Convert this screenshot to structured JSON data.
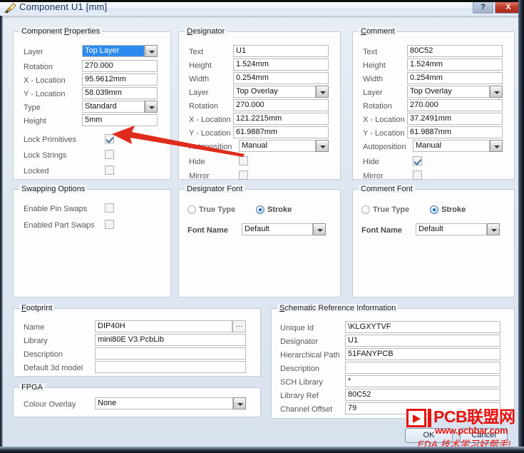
{
  "window": {
    "title": "Component U1 [mm]",
    "icon": "component-pencil-icon",
    "help_label": "?",
    "close_label": "X",
    "accent_blue": "#2d8bef",
    "watermark_red": "#e8140f"
  },
  "component_properties": {
    "title": "Component Properties",
    "title_prefix": "Component ",
    "title_underlined": "P",
    "title_suffix": "roperties",
    "rows": [
      {
        "label": "Layer",
        "value": "Top Layer",
        "type": "combo-selected"
      },
      {
        "label": "Rotation",
        "value": "270.000",
        "type": "text"
      },
      {
        "label": "X - Location",
        "value": "95.9612mm",
        "type": "text"
      },
      {
        "label": "Y - Location",
        "value": "58.039mm",
        "type": "text"
      },
      {
        "label": "Type",
        "value": "Standard",
        "type": "combo"
      },
      {
        "label": "Height",
        "value": "5mm",
        "type": "text"
      }
    ],
    "checkboxes": [
      {
        "label": "Lock Primitives",
        "checked": true
      },
      {
        "label": "Lock Strings",
        "checked": false
      },
      {
        "label": "Locked",
        "checked": false
      }
    ]
  },
  "designator": {
    "title": "Designator",
    "title_underlined": "D",
    "title_suffix": "esignator",
    "rows": [
      {
        "label": "Text",
        "value": "U1",
        "type": "text"
      },
      {
        "label": "Height",
        "value": "1.524mm",
        "type": "text"
      },
      {
        "label": "Width",
        "value": "0.254mm",
        "type": "text"
      },
      {
        "label": "Layer",
        "value": "Top Overlay",
        "type": "combo"
      },
      {
        "label": "Rotation",
        "value": "270.000",
        "type": "text"
      },
      {
        "label": "X - Location",
        "value": "121.2215mm",
        "type": "text"
      },
      {
        "label": "Y - Location",
        "value": "61.9887mm",
        "type": "text"
      },
      {
        "label": "Autoposition",
        "value": "Manual",
        "type": "combo"
      }
    ],
    "checkboxes": [
      {
        "label": "Hide",
        "checked": false
      },
      {
        "label": "Mirror",
        "checked": false
      }
    ]
  },
  "comment": {
    "title": "Comment",
    "title_underlined": "C",
    "title_suffix": "omment",
    "rows": [
      {
        "label": "Text",
        "value": "80C52",
        "type": "text"
      },
      {
        "label": "Height",
        "value": "1.524mm",
        "type": "text"
      },
      {
        "label": "Width",
        "value": "0.254mm",
        "type": "text"
      },
      {
        "label": "Layer",
        "value": "Top Overlay",
        "type": "combo"
      },
      {
        "label": "Rotation",
        "value": "270.000",
        "type": "text"
      },
      {
        "label": "X - Location",
        "value": "37.2491mm",
        "type": "text"
      },
      {
        "label": "Y - Location",
        "value": "61.9887mm",
        "type": "text"
      },
      {
        "label": "Autoposition",
        "value": "Manual",
        "type": "combo"
      }
    ],
    "checkboxes": [
      {
        "label": "Hide",
        "checked": true
      },
      {
        "label": "Mirror",
        "checked": false
      }
    ]
  },
  "swapping_options": {
    "title": "Swapping Options",
    "checkboxes": [
      {
        "label": "Enable Pin Swaps",
        "checked": false
      },
      {
        "label": "Enabled Part Swaps",
        "checked": false
      }
    ]
  },
  "designator_font": {
    "title": "Designator Font",
    "options": [
      {
        "label": "True Type",
        "selected": false
      },
      {
        "label": "Stroke",
        "selected": true
      }
    ],
    "font_name_label": "Font Name",
    "font_name_value": "Default"
  },
  "comment_font": {
    "title": "Comment Font",
    "options": [
      {
        "label": "True Type",
        "selected": false
      },
      {
        "label": "Stroke",
        "selected": true
      }
    ],
    "font_name_label": "Font Name",
    "font_name_value": "Default"
  },
  "footprint": {
    "title": "Footprint",
    "title_underlined": "F",
    "title_suffix": "ootprint",
    "browse_label": "...",
    "rows": [
      {
        "label": "Name",
        "value": "DIP40H"
      },
      {
        "label": "Library",
        "value": "mini80E V3.PcbLib"
      },
      {
        "label": "Description",
        "value": ""
      },
      {
        "label": "Default 3d model",
        "value": ""
      }
    ]
  },
  "fpga": {
    "title": "FPGA",
    "label": "Colour Overlay",
    "value": "None"
  },
  "schematic_reference": {
    "title": "Schematic Reference Information",
    "title_underlined": "S",
    "title_suffix": "chematic Reference Information",
    "rows": [
      {
        "label": "Unique Id",
        "value": "\\KLGXYTVF"
      },
      {
        "label": "Designator",
        "value": "U1"
      },
      {
        "label": "Hierarchical Path",
        "value": "51FANYPCB"
      },
      {
        "label": "Description",
        "value": ""
      },
      {
        "label": "SCH Library",
        "value": "*"
      },
      {
        "label": "Library Ref",
        "value": "80C52"
      },
      {
        "label": "Channel Offset",
        "value": "79"
      }
    ]
  },
  "buttons": {
    "ok": "OK",
    "cancel": "Cancel"
  },
  "watermark": {
    "brand": "PCB联盟网",
    "url": "www.pcbbar.com",
    "slogan": "EDA 技术学习好帮手!"
  }
}
